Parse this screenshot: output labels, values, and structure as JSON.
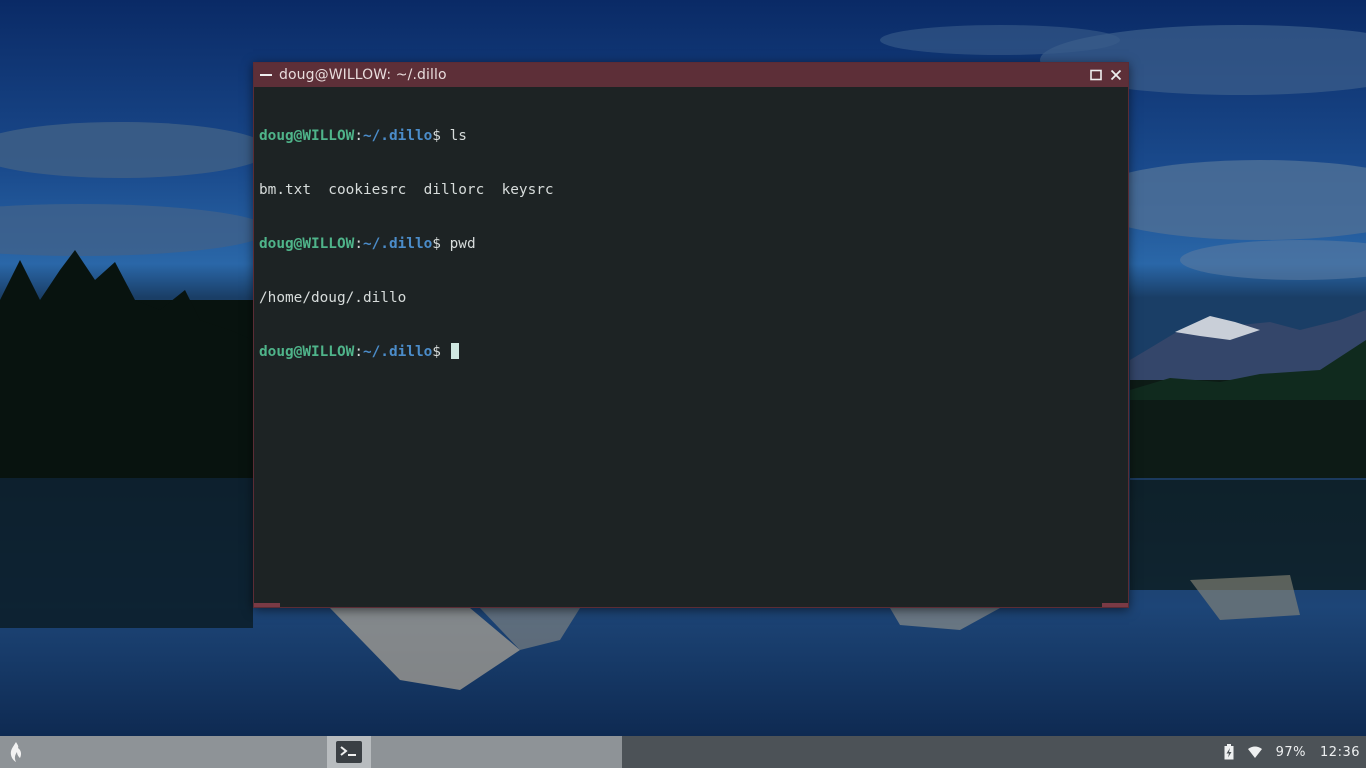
{
  "window": {
    "title": "doug@WILLOW: ~/.dillo",
    "accent": "#5d2f38"
  },
  "terminal": {
    "prompt_user": "doug@WILLOW",
    "prompt_sep": ":",
    "prompt_path": "~/.dillo",
    "prompt_dollar": "$",
    "lines": [
      {
        "kind": "prompt",
        "command": " ls"
      },
      {
        "kind": "output",
        "text": "bm.txt  cookiesrc  dillorc  keysrc"
      },
      {
        "kind": "prompt",
        "command": " pwd"
      },
      {
        "kind": "output",
        "text": "/home/doug/.dillo"
      },
      {
        "kind": "prompt",
        "command": " "
      }
    ],
    "colors": {
      "user": "#4fb48a",
      "path": "#4b8cc9",
      "background": "#1d2324"
    }
  },
  "taskbar": {
    "start_icon": "flame-icon",
    "task_icon": "terminal-icon",
    "tray": {
      "battery_icon": "battery-charging-icon",
      "wifi_icon": "wifi-icon",
      "battery_percent": "97%",
      "clock": "12:36"
    }
  }
}
